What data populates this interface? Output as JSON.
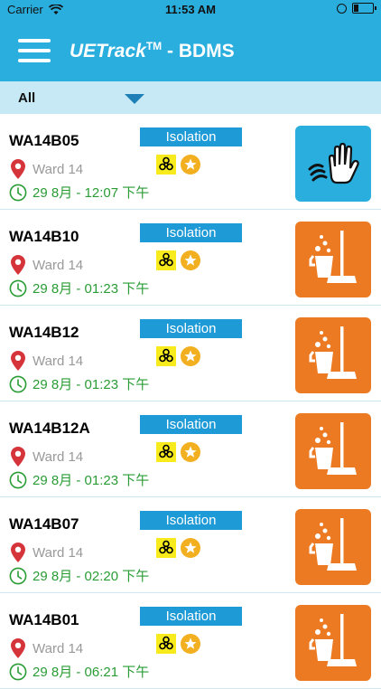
{
  "status_bar": {
    "carrier": "Carrier",
    "time": "11:53 AM"
  },
  "header": {
    "title_brand": "UETrack",
    "title_tm": "TM",
    "title_rest": " - BDMS"
  },
  "filter": {
    "selected": "All"
  },
  "rows": [
    {
      "code": "WA14B05",
      "tag": "Isolation",
      "ward": "Ward 14",
      "time": "29 8月 - 12:07 下午",
      "action_icon": "hand-wipe-icon"
    },
    {
      "code": "WA14B10",
      "tag": "Isolation",
      "ward": "Ward 14",
      "time": "29 8月 - 01:23 下午",
      "action_icon": "mop-bucket-icon"
    },
    {
      "code": "WA14B12",
      "tag": "Isolation",
      "ward": "Ward 14",
      "time": "29 8月 - 01:23 下午",
      "action_icon": "mop-bucket-icon"
    },
    {
      "code": "WA14B12A",
      "tag": "Isolation",
      "ward": "Ward 14",
      "time": "29 8月 - 01:23 下午",
      "action_icon": "mop-bucket-icon"
    },
    {
      "code": "WA14B07",
      "tag": "Isolation",
      "ward": "Ward 14",
      "time": "29 8月 - 02:20 下午",
      "action_icon": "mop-bucket-icon"
    },
    {
      "code": "WA14B01",
      "tag": "Isolation",
      "ward": "Ward 14",
      "time": "29 8月 - 06:21 下午",
      "action_icon": "mop-bucket-icon"
    }
  ],
  "colors": {
    "header": "#2aaede",
    "filter_bg": "#c7e9f6",
    "tag": "#1e9ad6",
    "time_green": "#2a9c35",
    "mop_button": "#ec7a22",
    "clean_button": "#2aaede"
  }
}
